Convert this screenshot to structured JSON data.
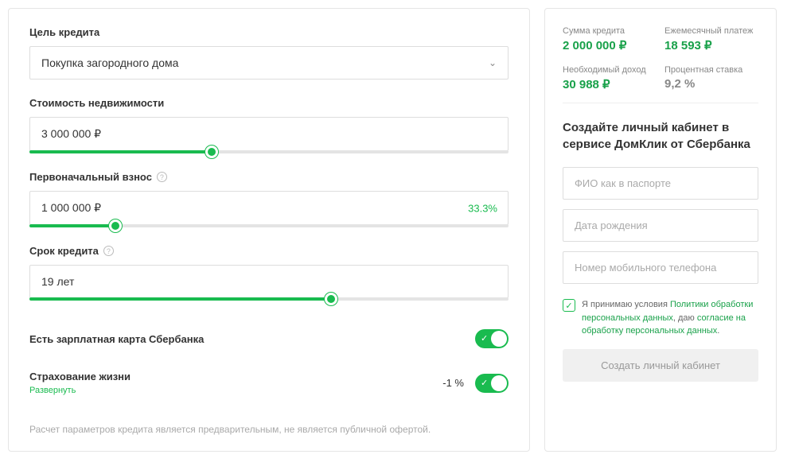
{
  "calc": {
    "purpose": {
      "label": "Цель кредита",
      "value": "Покупка загородного дома"
    },
    "property_cost": {
      "label": "Стоимость недвижимости",
      "value": "3 000 000 ₽",
      "slider_percent": 38
    },
    "down_payment": {
      "label": "Первоначальный взнос",
      "value": "1 000 000 ₽",
      "percent_badge": "33.3%",
      "slider_percent": 18
    },
    "term": {
      "label": "Срок кредита",
      "value": "19 лет",
      "slider_percent": 63
    },
    "salary_card": {
      "label": "Есть зарплатная карта Сбербанка",
      "on": true
    },
    "life_insurance": {
      "label": "Страхование жизни",
      "expand": "Развернуть",
      "delta": "-1 %",
      "on": true
    },
    "disclaimer": "Расчет параметров кредита является предварительным, не является публичной офертой."
  },
  "summary": {
    "loan_amount": {
      "label": "Сумма кредита",
      "value": "2 000 000 ₽"
    },
    "monthly": {
      "label": "Ежемесячный платеж",
      "value": "18 593 ₽"
    },
    "income": {
      "label": "Необходимый доход",
      "value": "30 988 ₽"
    },
    "rate": {
      "label": "Процентная ставка",
      "value": "9,2 %"
    }
  },
  "signup": {
    "title": "Создайте личный кабинет в сервисе ДомКлик от Сбербанка",
    "placeholders": {
      "fio": "ФИО как в паспорте",
      "dob": "Дата рождения",
      "phone": "Номер мобильного телефона"
    },
    "consent": {
      "prefix": "Я принимаю условия ",
      "link1": "Политики обработки персональных данных",
      "mid": ", даю ",
      "link2": "согласие на обработку персональных данных",
      "suffix": "."
    },
    "submit": "Создать личный кабинет"
  }
}
